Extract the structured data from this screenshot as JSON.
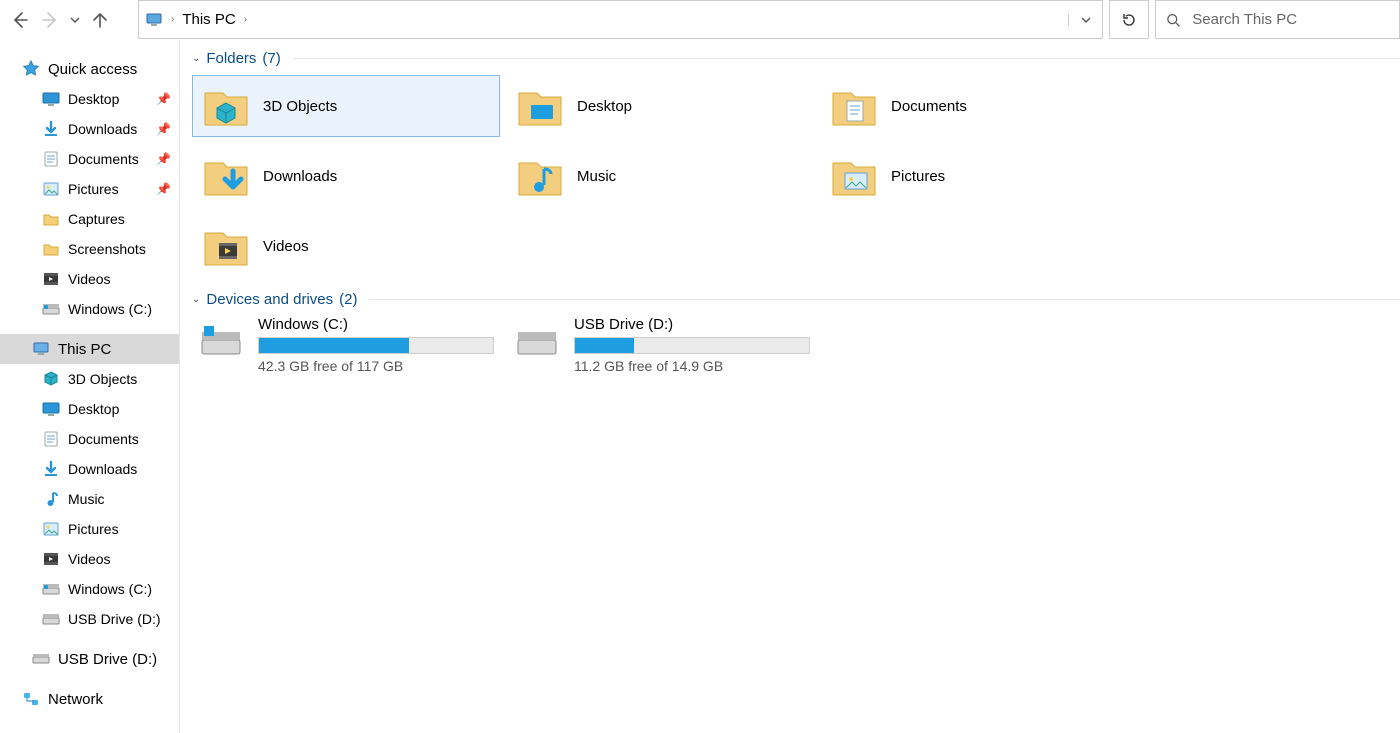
{
  "nav": {
    "back": "back",
    "forward": "forward",
    "recent": "recent",
    "up": "up"
  },
  "address": {
    "location": "This PC",
    "refresh": "refresh",
    "search_placeholder": "Search This PC"
  },
  "sidebar": {
    "quick_access": {
      "label": "Quick access",
      "items": [
        {
          "label": "Desktop",
          "icon": "desktop",
          "pinned": true
        },
        {
          "label": "Downloads",
          "icon": "downloads",
          "pinned": true
        },
        {
          "label": "Documents",
          "icon": "documents",
          "pinned": true
        },
        {
          "label": "Pictures",
          "icon": "pictures",
          "pinned": true
        },
        {
          "label": "Captures",
          "icon": "folder",
          "pinned": false
        },
        {
          "label": "Screenshots",
          "icon": "folder",
          "pinned": false
        },
        {
          "label": "Videos",
          "icon": "videos",
          "pinned": false
        },
        {
          "label": "Windows (C:)",
          "icon": "drive-c",
          "pinned": false
        }
      ]
    },
    "this_pc": {
      "label": "This PC",
      "items": [
        {
          "label": "3D Objects",
          "icon": "3dobjects"
        },
        {
          "label": "Desktop",
          "icon": "desktop"
        },
        {
          "label": "Documents",
          "icon": "documents"
        },
        {
          "label": "Downloads",
          "icon": "downloads"
        },
        {
          "label": "Music",
          "icon": "music"
        },
        {
          "label": "Pictures",
          "icon": "pictures"
        },
        {
          "label": "Videos",
          "icon": "videos"
        },
        {
          "label": "Windows (C:)",
          "icon": "drive-c"
        },
        {
          "label": "USB Drive (D:)",
          "icon": "drive-usb"
        }
      ]
    },
    "usb_root": {
      "label": "USB Drive (D:)"
    },
    "network": {
      "label": "Network"
    }
  },
  "groups": {
    "folders": {
      "title": "Folders",
      "count": "(7)",
      "items": [
        {
          "label": "3D Objects",
          "icon": "3dobjects",
          "selected": true
        },
        {
          "label": "Desktop",
          "icon": "desktop",
          "selected": false
        },
        {
          "label": "Documents",
          "icon": "documents",
          "selected": false
        },
        {
          "label": "Downloads",
          "icon": "downloads",
          "selected": false
        },
        {
          "label": "Music",
          "icon": "music",
          "selected": false
        },
        {
          "label": "Pictures",
          "icon": "pictures",
          "selected": false
        },
        {
          "label": "Videos",
          "icon": "videos",
          "selected": false
        }
      ]
    },
    "drives": {
      "title": "Devices and drives",
      "count": "(2)",
      "items": [
        {
          "label": "Windows (C:)",
          "icon": "drive-c",
          "free": "42.3 GB free of 117 GB",
          "used_pct": 64
        },
        {
          "label": "USB Drive (D:)",
          "icon": "drive-usb",
          "free": "11.2 GB free of 14.9 GB",
          "used_pct": 25
        }
      ]
    }
  }
}
